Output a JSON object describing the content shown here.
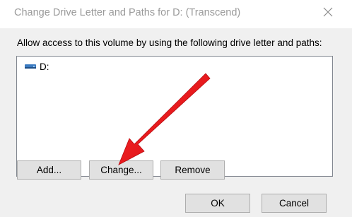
{
  "window": {
    "title": "Change Drive Letter and Paths for D: (Transcend)",
    "close_icon": "close-icon"
  },
  "dialog": {
    "instruction": "Allow access to this volume by using the following drive letter and paths:",
    "list": {
      "items": [
        {
          "label": "D:",
          "icon": "drive-icon"
        }
      ]
    },
    "buttons": {
      "add": "Add...",
      "change": "Change...",
      "remove": "Remove",
      "ok": "OK",
      "cancel": "Cancel"
    }
  },
  "annotation": {
    "arrow_color": "#e8151b",
    "arrow_target": "Change..."
  }
}
